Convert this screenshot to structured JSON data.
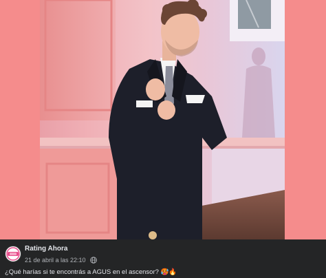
{
  "post": {
    "page_name": "Rating Ahora",
    "timestamp": "21 de abril a las 22:10",
    "caption": "¿Qué harías si te encontrás a AGUS en el ascensor? 🥵🔥",
    "avatar_text": "RATING AHORA"
  },
  "photo": {
    "description_subject": "man in dark suit adjusting cufflink",
    "background_color": "#f58c8c"
  },
  "colors": {
    "post_bar": "#242526",
    "text_primary": "#e4e6eb",
    "text_secondary": "#b0b3b8"
  }
}
